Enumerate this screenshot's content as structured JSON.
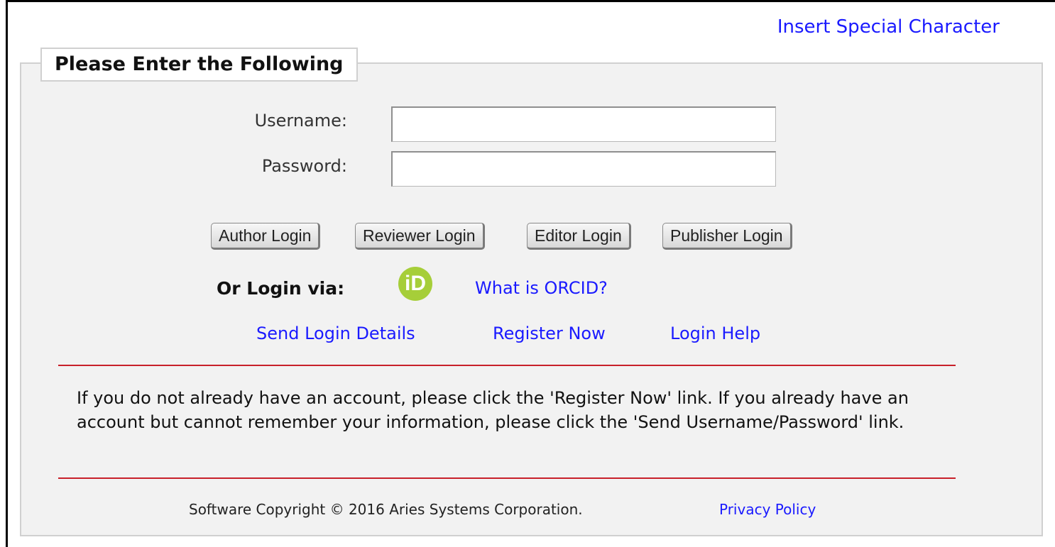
{
  "header": {
    "special_character_link": "Insert Special Character"
  },
  "form": {
    "legend": "Please Enter the Following",
    "username_label": "Username:",
    "username_value": "",
    "password_label": "Password:",
    "password_value": ""
  },
  "buttons": {
    "author": "Author Login",
    "reviewer": "Reviewer Login",
    "editor": "Editor Login",
    "publisher": "Publisher Login"
  },
  "alt_login": {
    "label": "Or Login via:",
    "orcid_icon_text": "iD",
    "orcid_help_link": "What is ORCID?"
  },
  "links": {
    "send_login_details": "Send Login Details",
    "register_now": "Register Now",
    "login_help": "Login Help"
  },
  "info_text": "If you do not already have an account, please click the 'Register Now' link. If you already have an account but cannot remember your information, please click the 'Send Username/Password' link.",
  "footer": {
    "copyright": "Software Copyright © 2016 Aries Systems Corporation.",
    "privacy_link": "Privacy Policy"
  },
  "colors": {
    "link": "#1a1aff",
    "rule": "#c8202a",
    "orcid": "#a6ce39",
    "panel": "#f2f2f2"
  },
  "icons": {
    "orcid": "orcid-icon"
  }
}
